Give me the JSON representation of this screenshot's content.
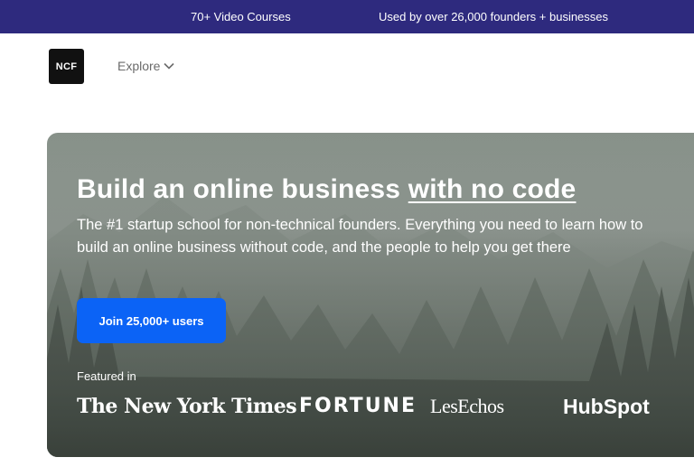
{
  "topbar": {
    "courses": "70+ Video Courses",
    "founders": "Used by over 26,000 founders + businesses"
  },
  "nav": {
    "logo_text": "NCF",
    "explore_label": "Explore"
  },
  "hero": {
    "headline_part1": "Build an online business ",
    "headline_part2": "with no code",
    "subtitle": "The #1 startup school for non-technical founders. Everything you need to learn how to build an online business without code, and the people to help you get there",
    "cta_label": "Join 25,000+ users",
    "featured_label": "Featured in",
    "press": [
      "The New York Times",
      "FORTUNE",
      "LesEchos",
      "HubSpot"
    ]
  },
  "icons": {
    "explore": "chevron-down-icon"
  },
  "colors": {
    "topbar": "#2e2a7e",
    "cta": "#0b63f6",
    "logo": "#111111"
  }
}
